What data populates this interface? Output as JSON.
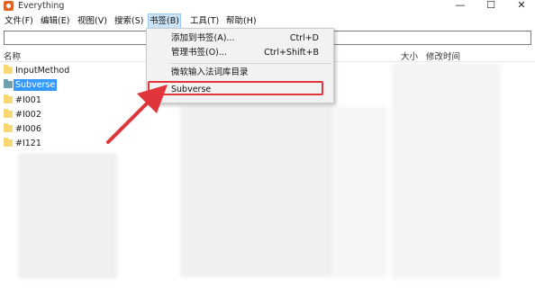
{
  "window": {
    "title": "Everything",
    "icon": "everything-app-icon",
    "controls": {
      "minimize": "—",
      "maximize": "☐",
      "close": "✕"
    }
  },
  "menubar": {
    "items": [
      {
        "label": "文件(F)"
      },
      {
        "label": "编辑(E)"
      },
      {
        "label": "视图(V)"
      },
      {
        "label": "搜索(S)"
      },
      {
        "label": "书签(B)"
      },
      {
        "label": "工具(T)"
      },
      {
        "label": "帮助(H)"
      }
    ],
    "active": "书签(B)"
  },
  "search": {
    "value": ""
  },
  "columns": {
    "name": "名称",
    "size": "大小",
    "modified": "修改时间"
  },
  "rows": [
    {
      "name": "InputMethod",
      "selected": false
    },
    {
      "name": "Subverse",
      "selected": true
    },
    {
      "name": "#I001",
      "selected": false
    },
    {
      "name": "#I002",
      "selected": false
    },
    {
      "name": "#I006",
      "selected": false
    },
    {
      "name": "#I121",
      "selected": false
    }
  ],
  "bookmarks_menu": {
    "add": {
      "label": "添加到书签(A)...",
      "shortcut": "Ctrl+D"
    },
    "manage": {
      "label": "管理书签(O)...",
      "shortcut": "Ctrl+Shift+B"
    },
    "bookmark1": {
      "label": "微软输入法词库目录"
    },
    "bookmark2": {
      "label": "Subverse"
    }
  },
  "colors": {
    "selection": "#3399ff",
    "menu_active": "#cce4f7",
    "annotation": "#e0353a",
    "folder": "#f8d775"
  }
}
